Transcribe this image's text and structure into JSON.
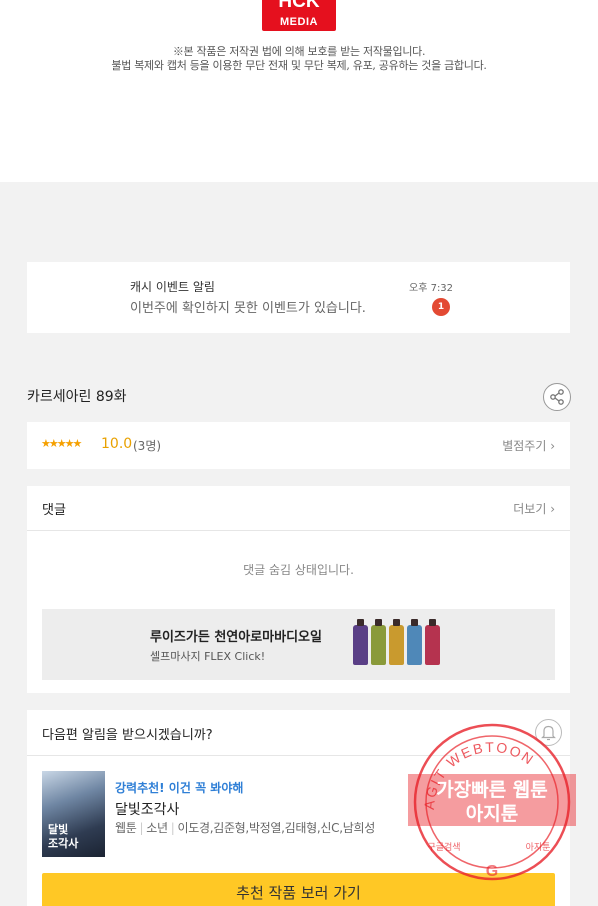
{
  "logo": {
    "line1": "HCK",
    "line2": "MEDIA"
  },
  "copyright": {
    "line1": "※본 작품은 저작권 법에 의해 보호를 받는 저작물입니다.",
    "line2": "불법 복제와 캡처 등을 이용한 무단 전재 및 무단 복제, 유포, 공유하는 것을 금합니다."
  },
  "notification": {
    "title": "캐시 이벤트 알림",
    "message": "이번주에 확인하지 못한 이벤트가 있습니다.",
    "time": "오후 7:32",
    "badge": "1"
  },
  "episode": {
    "title": "카르세아린 89화",
    "share_icon": "share-icon"
  },
  "rating": {
    "stars": "★★★★★",
    "score": "10.0",
    "count": "(3명)",
    "rate_button": "별점주기 ›"
  },
  "comments": {
    "title": "댓글",
    "more": "더보기 ›",
    "hidden_message": "댓글 숨김 상태입니다."
  },
  "ad": {
    "title": "루이즈가든 천연아로마바디오일",
    "subtitle": "셀프마사지 FLEX Click!",
    "bottle_colors": [
      "#5a3f86",
      "#8a9a3a",
      "#c99a2e",
      "#4f88b8",
      "#b5334f"
    ]
  },
  "next_episode": {
    "question": "다음편 알림을 받으시겠습니까?",
    "bell_icon": "bell-icon"
  },
  "recommendation": {
    "label": "강력추천! 이건 꼭 봐야해",
    "title": "달빛조각사",
    "thumb_title": "달빛\n조각사",
    "type": "웹툰",
    "genre": "소년",
    "authors": "이도경,김준형,박정열,김태형,신C,남희성",
    "cta": "추천 작품 보러 가기"
  },
  "watermark": {
    "ring_text": "AGIT WEBTOON",
    "main_line1": "가장빠른 웹툰",
    "main_line2": "아지툰",
    "bottom_left": "구글검색",
    "bottom_right": "아지툰",
    "bottom_mark": "G",
    "color": "#e8232b"
  }
}
